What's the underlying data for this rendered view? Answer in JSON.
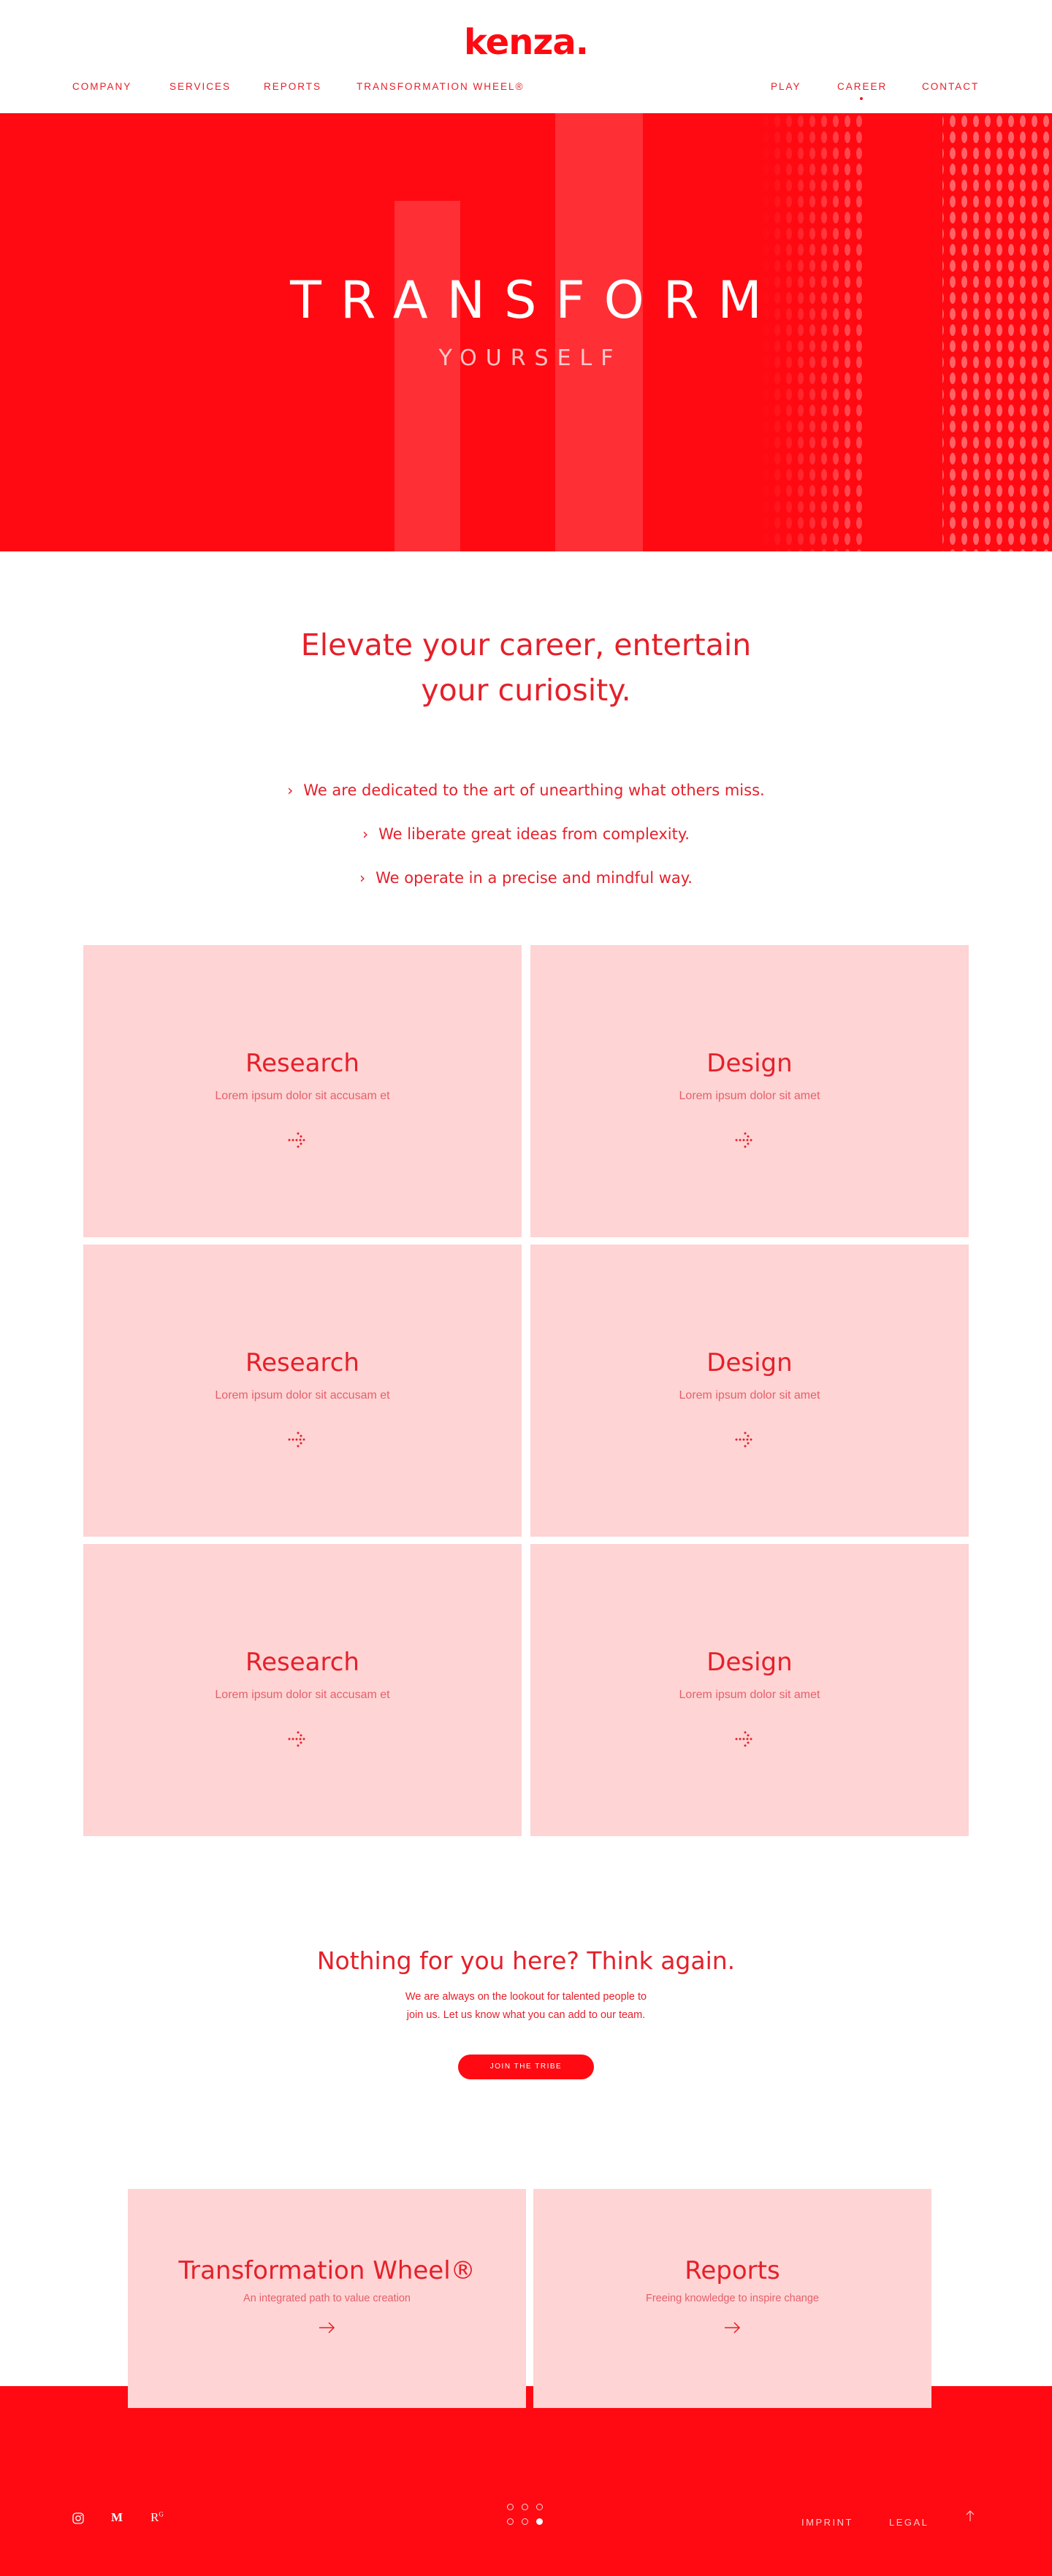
{
  "brand": {
    "logo": "kenza.",
    "accent": "#ff0a12",
    "text_red": "#e5202a",
    "card_pink": "#fed4d4"
  },
  "nav": {
    "left": [
      "COMPANY",
      "SERVICES",
      "REPORTS",
      "TRANSFORMATION WHEEL®"
    ],
    "right": [
      "PLAY",
      "CAREER",
      "CONTACT"
    ],
    "active": "CAREER"
  },
  "hero": {
    "title": "TRANSFORM",
    "subtitle": "YOURSELF"
  },
  "intro": {
    "heading_line1": "Elevate your career, entertain",
    "heading_line2": "your curiosity.",
    "bullets": [
      "We are dedicated to the art of unearthing what others miss.",
      "We liberate great ideas from complexity.",
      "We operate in a precise and mindful way."
    ]
  },
  "cards": [
    {
      "title": "Research",
      "subtitle": "Lorem ipsum dolor sit accusam et",
      "icon": "dotted-arrow-right-icon"
    },
    {
      "title": "Design",
      "subtitle": "Lorem ipsum dolor sit amet",
      "icon": "dotted-arrow-right-icon"
    },
    {
      "title": "Research",
      "subtitle": "Lorem ipsum dolor sit accusam et",
      "icon": "dotted-arrow-right-icon"
    },
    {
      "title": "Design",
      "subtitle": "Lorem ipsum dolor sit amet",
      "icon": "dotted-arrow-right-icon"
    },
    {
      "title": "Research",
      "subtitle": "Lorem ipsum dolor sit accusam et",
      "icon": "dotted-arrow-right-icon"
    },
    {
      "title": "Design",
      "subtitle": "Lorem ipsum dolor sit amet",
      "icon": "dotted-arrow-right-icon"
    }
  ],
  "cta": {
    "heading": "Nothing for you here? Think again.",
    "text_line1": "We are always on the lookout for talented people to",
    "text_line2": "join us. Let us know what you can add to our team.",
    "button": "JOIN THE TRIBE"
  },
  "promos": [
    {
      "title": "Transformation Wheel®",
      "subtitle": "An integrated path to value creation",
      "icon": "arrow-right-icon"
    },
    {
      "title": "Reports",
      "subtitle": "Freeing knowledge to inspire change",
      "icon": "arrow-right-icon"
    }
  ],
  "footer": {
    "social": [
      {
        "name": "instagram-icon",
        "glyph": "◎"
      },
      {
        "name": "medium-icon",
        "glyph": "M"
      },
      {
        "name": "researchgate-icon",
        "glyph": "R"
      }
    ],
    "links": [
      "IMPRINT",
      "LEGAL"
    ],
    "back_to_top_icon": "arrow-up-icon",
    "pager_dots": 6,
    "pager_active": 6
  }
}
